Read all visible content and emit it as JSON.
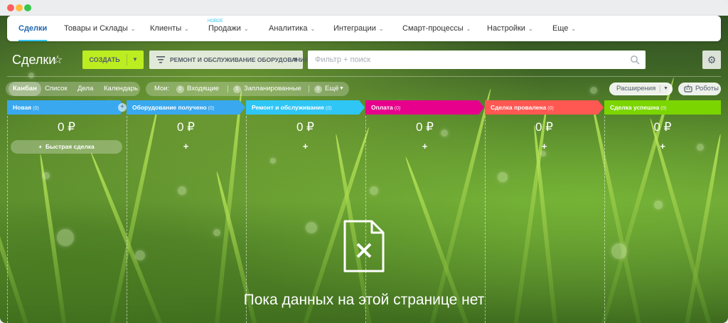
{
  "topnav": {
    "items": [
      {
        "label": "Сделки",
        "has_chevron": false,
        "active": true
      },
      {
        "label": "Товары и Склады",
        "has_chevron": true
      },
      {
        "label": "Клиенты",
        "has_chevron": true
      },
      {
        "label": "Продажи",
        "has_chevron": true,
        "badge": "НОВОЕ"
      },
      {
        "label": "Аналитика",
        "has_chevron": true
      },
      {
        "label": "Интеграции",
        "has_chevron": true
      },
      {
        "label": "Смарт-процессы",
        "has_chevron": true
      },
      {
        "label": "Настройки",
        "has_chevron": true
      },
      {
        "label": "Еще",
        "has_chevron": true
      }
    ]
  },
  "header": {
    "title": "Сделки",
    "create_label": "СОЗДАТЬ",
    "pipeline_label": "РЕМОНТ И ОБСЛУЖИВАНИЕ ОБОРУДОВАНИЯ",
    "search_placeholder": "Фильтр + поиск"
  },
  "views": {
    "tabs": [
      {
        "label": "Канбан",
        "active": true
      },
      {
        "label": "Список"
      },
      {
        "label": "Дела"
      },
      {
        "label": "Календарь"
      }
    ]
  },
  "counters": {
    "title": "Мои:",
    "items": [
      {
        "count": "0",
        "label": "Входящие"
      },
      {
        "count": "0",
        "label": "Запланированные"
      },
      {
        "count": "0",
        "label": "Ещё"
      }
    ]
  },
  "toolbar": {
    "extensions_label": "Расширения",
    "robots_label": "Роботы"
  },
  "stages": [
    {
      "name": "Новая",
      "count": "(0)",
      "total": "0 ₽",
      "color": "#39a8ef"
    },
    {
      "name": "Оборудование получено",
      "count": "(0)",
      "total": "0 ₽",
      "color": "#39a8ef"
    },
    {
      "name": "Ремонт и обслуживание",
      "count": "(0)",
      "total": "0 ₽",
      "color": "#2fc6f6"
    },
    {
      "name": "Оплата",
      "count": "(0)",
      "total": "0 ₽",
      "color": "#e6008c"
    },
    {
      "name": "Сделка провалена",
      "count": "(0)",
      "total": "0 ₽",
      "color": "#ff5752"
    },
    {
      "name": "Сделка успешна",
      "count": "(0)",
      "total": "0 ₽",
      "color": "#7bd500"
    }
  ],
  "quick_deal_label": "Быстрая сделка",
  "empty_state": {
    "text": "Пока данных на этой странице нет"
  }
}
